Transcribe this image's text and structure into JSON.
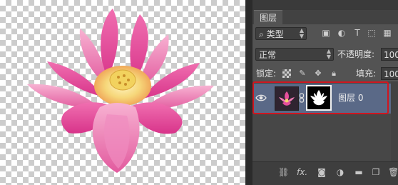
{
  "canvas": {
    "image": "lotus-flower-photo"
  },
  "layers_panel": {
    "tab_label": "图层",
    "filter": {
      "icon": "search-icon",
      "label": "类型",
      "icons": [
        "image-filter-icon",
        "adjustment-filter-icon",
        "type-filter-icon",
        "shape-filter-icon",
        "smart-object-filter-icon"
      ]
    },
    "blend_mode": "正常",
    "opacity_label": "不透明度:",
    "opacity_value": "100",
    "lock_label": "锁定:",
    "lock_icons": [
      "lock-transparent-icon",
      "lock-image-icon",
      "lock-position-icon",
      "lock-all-icon"
    ],
    "fill_label": "填充:",
    "fill_value": "100",
    "layers": [
      {
        "name": "图层 0",
        "visible": true,
        "has_mask": true,
        "selected": true
      }
    ],
    "bottom_icons": [
      "link-layers-icon",
      "fx-icon",
      "add-mask-icon",
      "adjustment-layer-icon",
      "group-folder-icon",
      "new-layer-icon",
      "trash-icon"
    ],
    "fx_label": "fx."
  },
  "colors": {
    "selection_row": "#5a6987",
    "highlight_box": "#d0161f",
    "panel_bg": "#535353"
  }
}
